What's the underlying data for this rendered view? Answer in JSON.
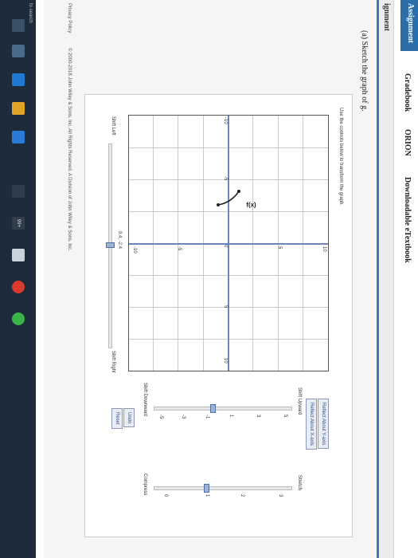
{
  "nav": {
    "tabs": [
      "Assignment",
      "Gradebook",
      "ORION",
      "Downloadable eTextbook"
    ],
    "active_index": 0
  },
  "subhead": {
    "title": "ignment"
  },
  "question": {
    "text": "(a) Sketch the graph of g."
  },
  "applet": {
    "instructions": "Use the controls below to transform the graph.",
    "function_label": "f(x)",
    "axis_ticks": {
      "x": [
        "-10",
        "-5",
        "0",
        "5",
        "10"
      ],
      "y": [
        "10",
        "5",
        "-5",
        "-10"
      ]
    },
    "readout": "9.4, -2.4",
    "controls": {
      "shift_left": "Shift Left",
      "shift_right": "Shift Right",
      "shift_upward": "Shift Upward",
      "shift_downward": "Shift Downward",
      "stretch": "Stretch",
      "compress": "Compress",
      "vertical_scale": [
        "5",
        "3",
        "1",
        "-1",
        "-3",
        "-5"
      ],
      "stretch_scale": [
        "3",
        "2",
        "1",
        "0"
      ],
      "buttons": {
        "reflect_y": "Reflect About Y-axis",
        "reflect_x": "Reflect About X-axis",
        "undo": "Undo",
        "reset": "Reset"
      }
    }
  },
  "footer": {
    "policy": "Privacy Policy",
    "copyright": "© 2000-2018 John Wiley & Sons, Inc. All Rights Reserved. A Division of John Wiley & Sons, Inc."
  },
  "taskbar": {
    "search_text": "to search",
    "badge": "99+"
  },
  "colors": {
    "accent": "#2e6ea8",
    "axis": "#6e86b8",
    "taskbar": "#1d2b3a"
  }
}
